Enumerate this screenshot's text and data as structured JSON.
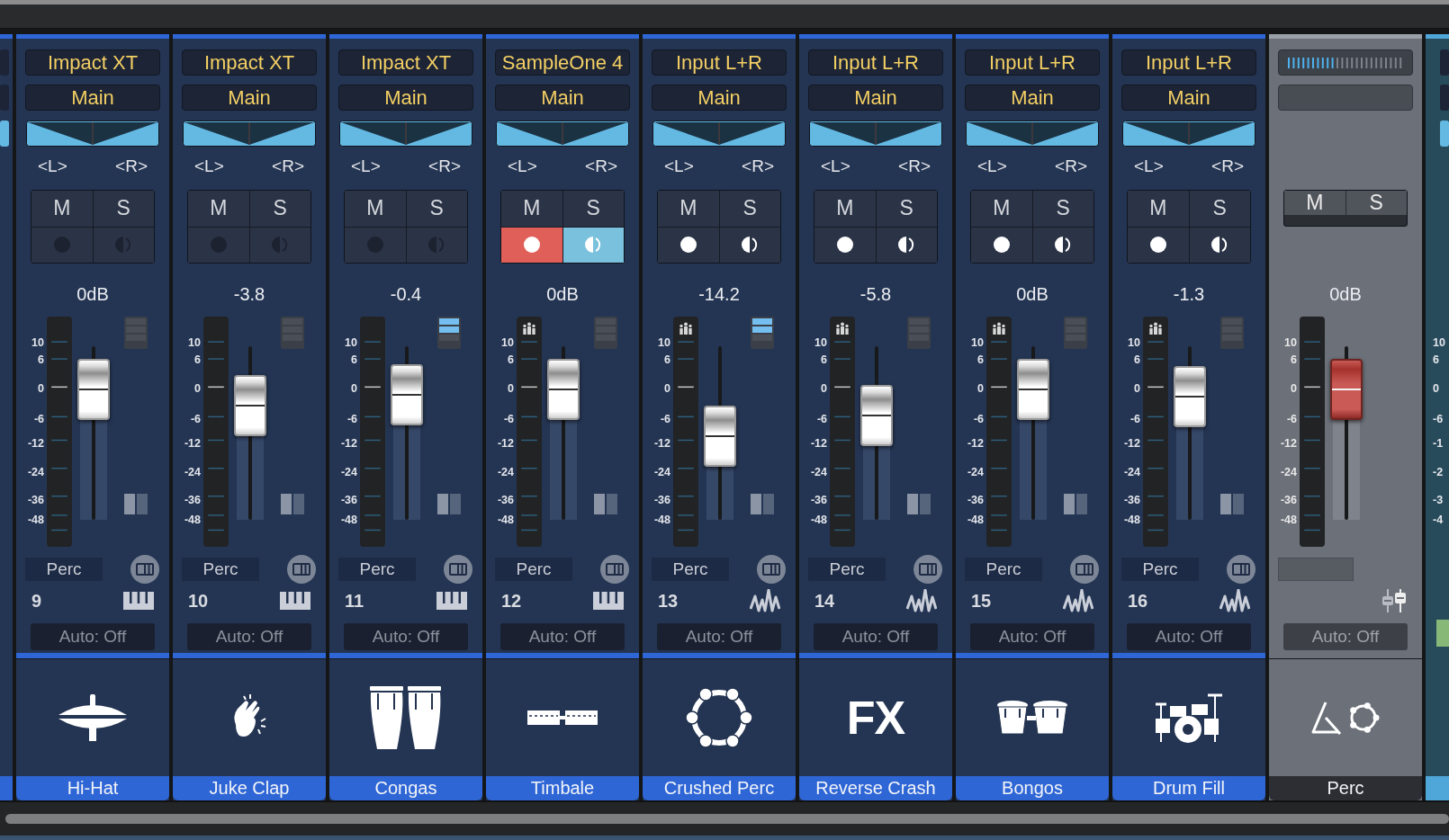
{
  "channels": [
    {
      "kind": "instrument",
      "source": "Impact XT",
      "output": "Main",
      "pan_left": "<L>",
      "pan_right": "<R>",
      "mute": "M",
      "solo": "S",
      "muted": false,
      "soloed": false,
      "record_armed": false,
      "monitor_on": false,
      "volume": "0dB",
      "level": 0.75,
      "group_badge": false,
      "stack_lit": false,
      "scale": [
        "10",
        "6",
        "0",
        "-6",
        "-12",
        "-24",
        "-36",
        "-48"
      ],
      "group_label": "Perc",
      "number": "9",
      "automation": "Auto: Off",
      "name": "Hi-Hat"
    },
    {
      "kind": "instrument",
      "source": "Impact XT",
      "output": "Main",
      "pan_left": "<L>",
      "pan_right": "<R>",
      "mute": "M",
      "solo": "S",
      "muted": false,
      "soloed": false,
      "record_armed": false,
      "monitor_on": false,
      "volume": "-3.8",
      "level": 0.66,
      "group_badge": false,
      "stack_lit": false,
      "scale": [
        "10",
        "6",
        "0",
        "-6",
        "-12",
        "-24",
        "-36",
        "-48"
      ],
      "group_label": "Perc",
      "number": "10",
      "automation": "Auto: Off",
      "name": "Juke Clap"
    },
    {
      "kind": "instrument",
      "source": "Impact XT",
      "output": "Main",
      "pan_left": "<L>",
      "pan_right": "<R>",
      "mute": "M",
      "solo": "S",
      "muted": false,
      "soloed": false,
      "record_armed": false,
      "monitor_on": false,
      "volume": "-0.4",
      "level": 0.72,
      "group_badge": false,
      "stack_lit": true,
      "scale": [
        "10",
        "6",
        "0",
        "-6",
        "-12",
        "-24",
        "-36",
        "-48"
      ],
      "group_label": "Perc",
      "number": "11",
      "automation": "Auto: Off",
      "name": "Congas"
    },
    {
      "kind": "instrument",
      "source": "SampleOne 4",
      "output": "Main",
      "pan_left": "<L>",
      "pan_right": "<R>",
      "mute": "M",
      "solo": "S",
      "muted": false,
      "soloed": false,
      "record_armed": true,
      "monitor_on": true,
      "volume": "0dB",
      "level": 0.75,
      "group_badge": true,
      "stack_lit": false,
      "scale": [
        "10",
        "6",
        "0",
        "-6",
        "-12",
        "-24",
        "-36",
        "-48"
      ],
      "group_label": "Perc",
      "number": "12",
      "automation": "Auto: Off",
      "name": "Timbale"
    },
    {
      "kind": "audio",
      "source": "Input L+R",
      "output": "Main",
      "pan_left": "<L>",
      "pan_right": "<R>",
      "mute": "M",
      "solo": "S",
      "muted": false,
      "soloed": false,
      "record_armed": false,
      "monitor_on": false,
      "volume": "-14.2",
      "level": 0.48,
      "group_badge": true,
      "stack_lit": true,
      "scale": [
        "10",
        "6",
        "0",
        "-6",
        "-12",
        "-24",
        "-36",
        "-48"
      ],
      "group_label": "Perc",
      "number": "13",
      "automation": "Auto: Off",
      "name": "Crushed Perc"
    },
    {
      "kind": "audio",
      "source": "Input L+R",
      "output": "Main",
      "pan_left": "<L>",
      "pan_right": "<R>",
      "mute": "M",
      "solo": "S",
      "muted": false,
      "soloed": false,
      "record_armed": false,
      "monitor_on": false,
      "volume": "-5.8",
      "level": 0.6,
      "group_badge": true,
      "stack_lit": false,
      "scale": [
        "10",
        "6",
        "0",
        "-6",
        "-12",
        "-24",
        "-36",
        "-48"
      ],
      "group_label": "Perc",
      "number": "14",
      "automation": "Auto: Off",
      "icon_label": "FX",
      "name": "Reverse Crash"
    },
    {
      "kind": "audio",
      "source": "Input L+R",
      "output": "Main",
      "pan_left": "<L>",
      "pan_right": "<R>",
      "mute": "M",
      "solo": "S",
      "muted": false,
      "soloed": false,
      "record_armed": false,
      "monitor_on": false,
      "volume": "0dB",
      "level": 0.75,
      "group_badge": true,
      "stack_lit": false,
      "scale": [
        "10",
        "6",
        "0",
        "-6",
        "-12",
        "-24",
        "-36",
        "-48"
      ],
      "group_label": "Perc",
      "number": "15",
      "automation": "Auto: Off",
      "name": "Bongos"
    },
    {
      "kind": "audio",
      "source": "Input L+R",
      "output": "Main",
      "pan_left": "<L>",
      "pan_right": "<R>",
      "mute": "M",
      "solo": "S",
      "muted": false,
      "soloed": false,
      "record_armed": false,
      "monitor_on": false,
      "volume": "-1.3",
      "level": 0.71,
      "group_badge": true,
      "stack_lit": false,
      "scale": [
        "10",
        "6",
        "0",
        "-6",
        "-12",
        "-24",
        "-36",
        "-48"
      ],
      "group_label": "Perc",
      "number": "16",
      "automation": "Auto: Off",
      "name": "Drum Fill"
    },
    {
      "kind": "bus",
      "top_meter": {
        "level": 0.42
      },
      "mute": "M",
      "solo": "S",
      "muted": false,
      "soloed": false,
      "volume": "0dB",
      "level": 0.75,
      "scale": [
        "10",
        "6",
        "0",
        "-6",
        "-12",
        "-24",
        "-36",
        "-48"
      ],
      "automation": "Auto: Off",
      "name": "Perc"
    }
  ],
  "edge_scale": [
    "10",
    "6",
    "0",
    "-6",
    "-1",
    "-2",
    "-3",
    "-4"
  ]
}
